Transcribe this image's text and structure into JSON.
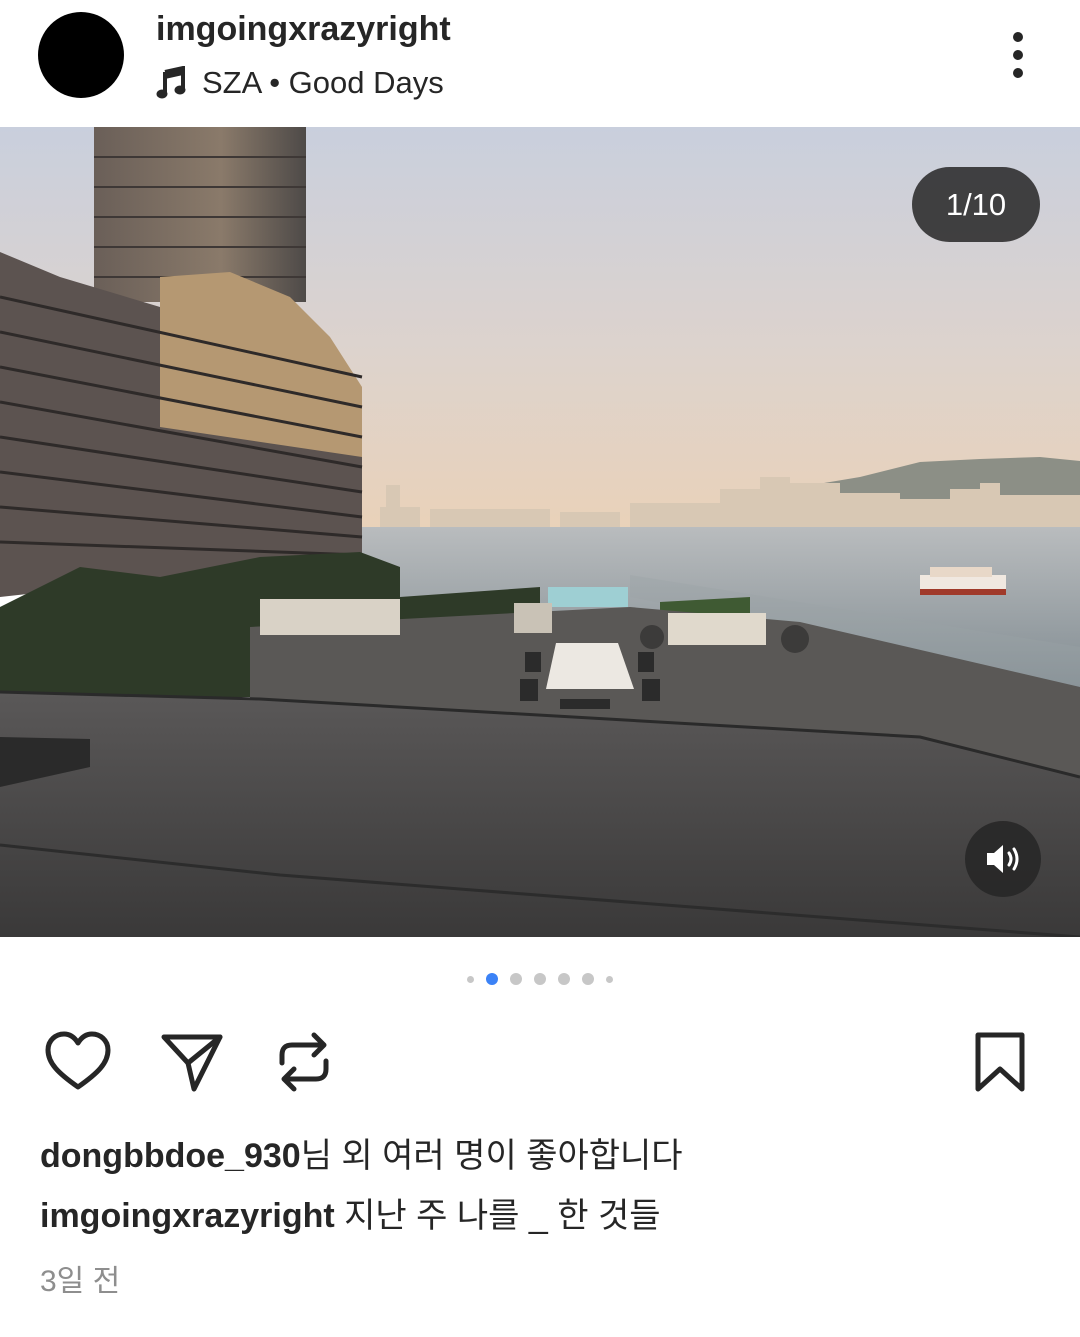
{
  "post": {
    "username": "imgoingxrazyright",
    "music": {
      "icon": "music-note-icon",
      "text": "SZA • Good Days"
    },
    "more_icon": "more-vertical-icon",
    "image": {
      "counter": "1/10",
      "sound_icon": "speaker-volume-icon",
      "current_index": 1,
      "total": 10
    },
    "actions": {
      "like_icon": "heart-icon",
      "share_icon": "paper-plane-icon",
      "repost_icon": "repost-icon",
      "save_icon": "bookmark-icon"
    },
    "likes": {
      "user": "dongbbdoe_930",
      "suffix": "님 외 여러 명이 좋아합니다"
    },
    "caption": {
      "user": "imgoingxrazyright",
      "text": " 지난 주 나를 _ 한 것들"
    },
    "timestamp": "3일 전"
  }
}
